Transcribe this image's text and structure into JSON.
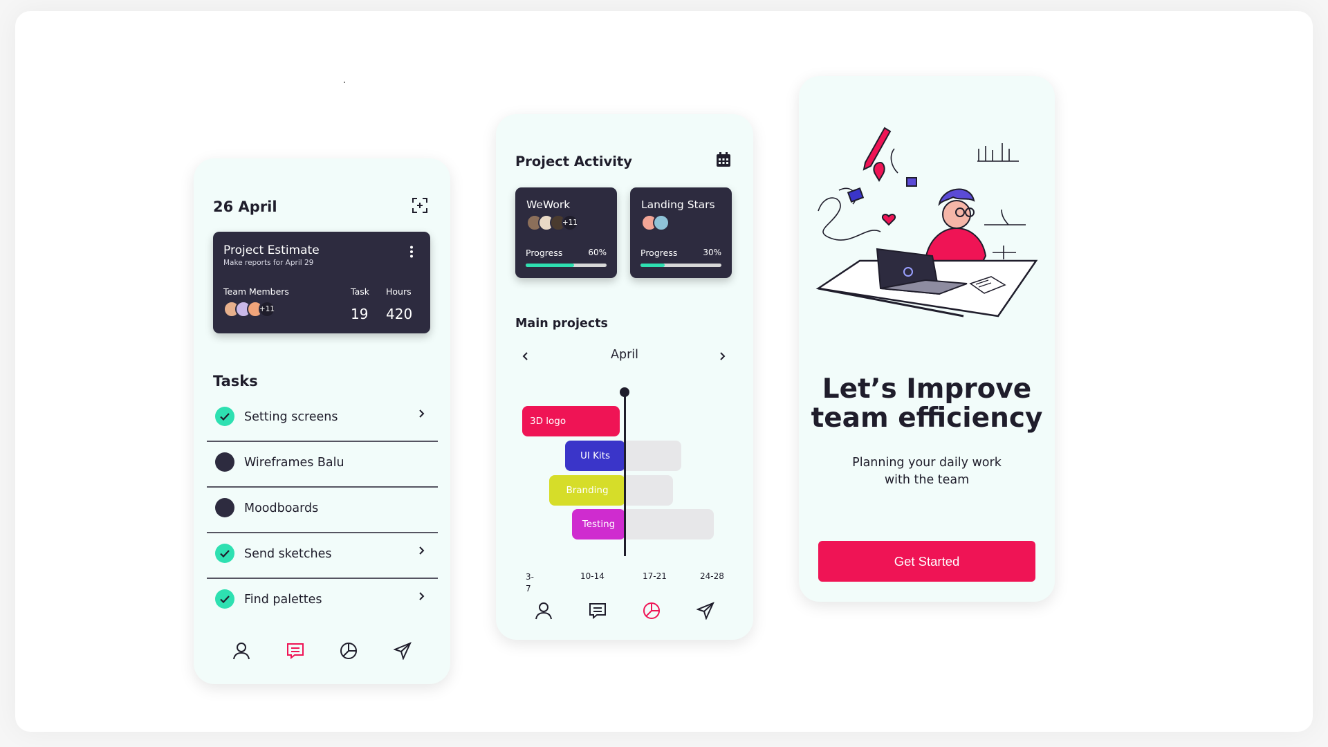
{
  "colors": {
    "accent": "#ef1455",
    "dark_card": "#2d2b3f",
    "success": "#2ee0b1",
    "phone_bg": "#f2fcfa",
    "ui_kits": "#3a35c9",
    "branding": "#d6dd29",
    "testing": "#cf2ccf"
  },
  "screen1": {
    "date": "26 April",
    "estimate": {
      "title": "Project Estimate",
      "subtitle": "Make reports for April 29",
      "members_label": "Team Members",
      "members_more": "+11",
      "task_label": "Task",
      "task_value": "19",
      "hours_label": "Hours",
      "hours_value": "420"
    },
    "tasks_title": "Tasks",
    "tasks": [
      {
        "label": "Setting screens",
        "done": true
      },
      {
        "label": "Wireframes Balu",
        "done": false
      },
      {
        "label": "Moodboards",
        "done": false
      },
      {
        "label": "Send sketches",
        "done": true
      },
      {
        "label": "Find palettes",
        "done": true
      }
    ],
    "nav_active": "chat-icon"
  },
  "screen2": {
    "title": "Project Activity",
    "projects": [
      {
        "name": "WeWork",
        "more": "+11",
        "progress_label": "Progress",
        "progress_text": "60%",
        "progress": 0.6
      },
      {
        "name": "Landing Stars",
        "more": "",
        "progress_label": "Progress",
        "progress_text": "30%",
        "progress": 0.3
      }
    ],
    "main_projects_title": "Main projects",
    "month": "April",
    "gantt": [
      {
        "label": "3D logo"
      },
      {
        "label": "UI Kits"
      },
      {
        "label": "Branding"
      },
      {
        "label": "Testing"
      }
    ],
    "weeks": [
      "3-\n7",
      "10-14",
      "17-21",
      "24-28"
    ],
    "nav_active": "chart-icon"
  },
  "screen3": {
    "title_line1": "Let’s Improve",
    "title_line2": "team efficiency",
    "subtitle_line1": "Planning your daily work",
    "subtitle_line2": "with the team",
    "cta": "Get Started"
  }
}
